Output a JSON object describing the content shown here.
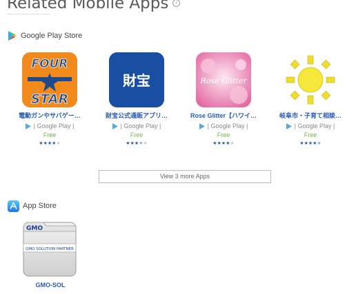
{
  "section_title": "Related Mobile Apps",
  "info_glyph": "i",
  "google_play": {
    "label": "Google Play Store",
    "apps": [
      {
        "name": "電動ガンやサバゲー…",
        "store": "| Google Play |",
        "price": "Free",
        "rating": 4,
        "icon_text_top": "FOUR",
        "icon_text_bottom": "STAR",
        "icon": "four-star-logo-icon"
      },
      {
        "name": "財宝公式通販アプリ…",
        "store": "| Google Play |",
        "price": "Free",
        "rating": 3.5,
        "icon_text": "財宝",
        "icon": "zaiho-logo-icon"
      },
      {
        "name": "Rose Glitter【ハワイ…",
        "store": "| Google Play |",
        "price": "Free",
        "rating": 4,
        "icon_text": "Rose Glitter",
        "icon": "rose-glitter-icon"
      },
      {
        "name": "岐阜市・子育て相談…",
        "store": "| Google Play |",
        "price": "Free",
        "rating": 4.5,
        "icon": "sun-icon"
      }
    ],
    "more_label": "View 3 more Apps"
  },
  "app_store": {
    "label": "App Store",
    "apps": [
      {
        "name": "GMO-SOL",
        "icon_text_top": "GMO",
        "icon_text_band": "GMO SOLUTION PARTNER",
        "icon": "gmo-folder-icon"
      }
    ]
  },
  "colors": {
    "link": "#2a5bb0",
    "price": "#7bb24a",
    "star": "#2f5aa0"
  }
}
